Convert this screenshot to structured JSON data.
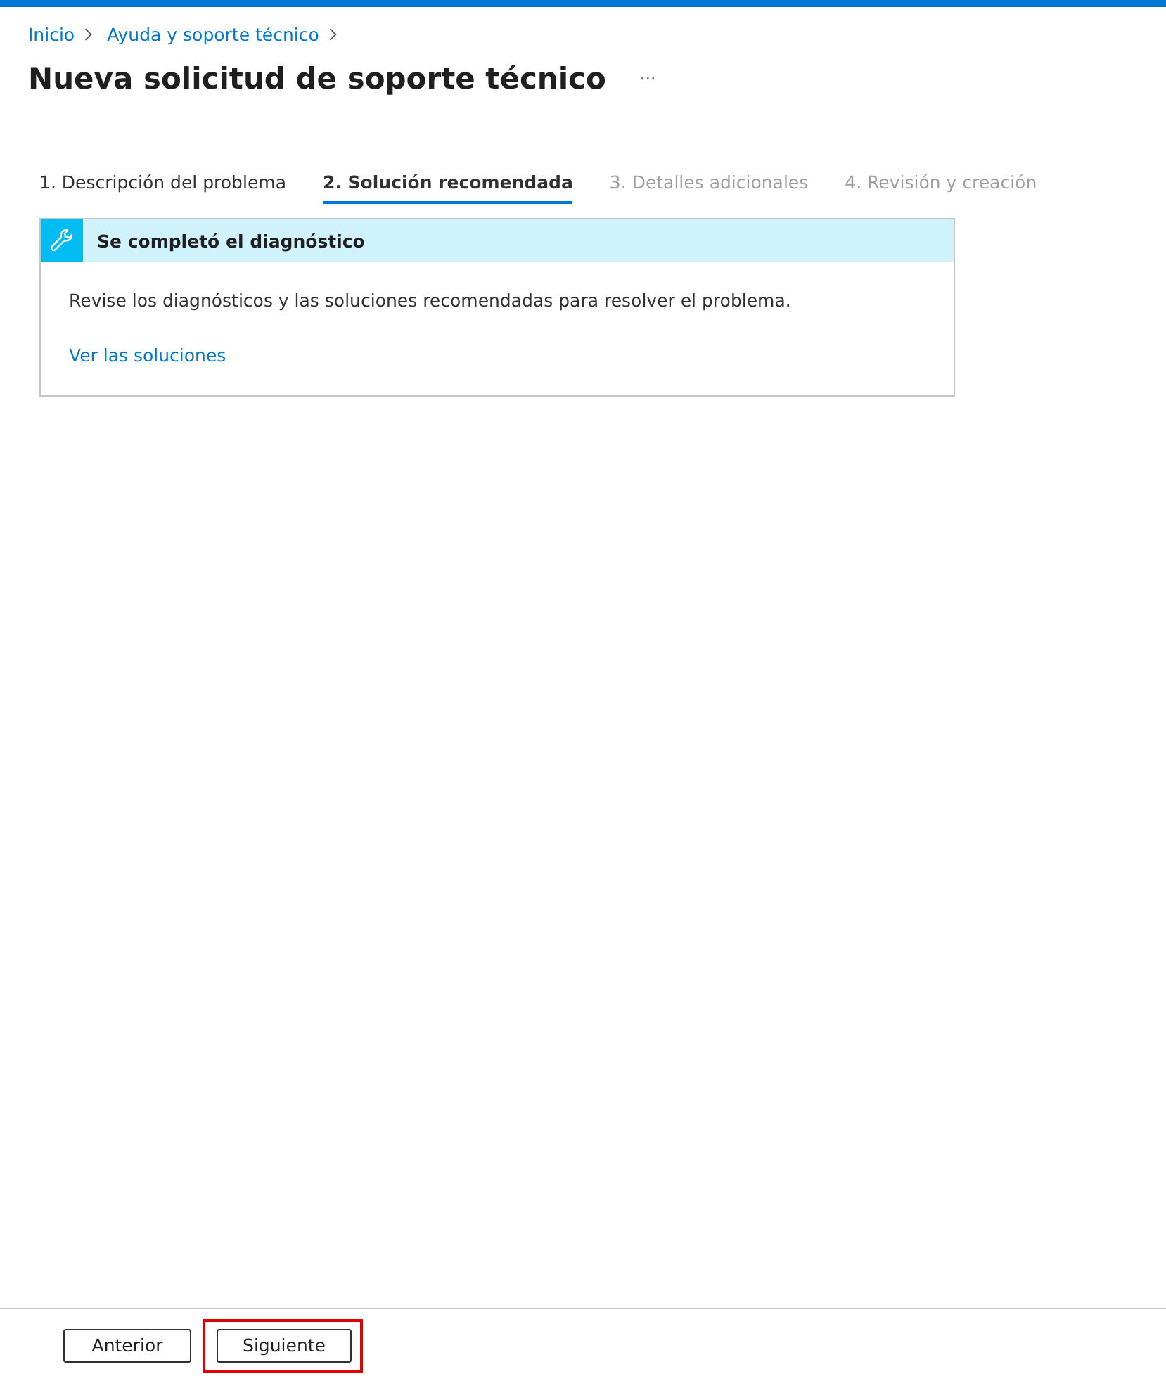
{
  "breadcrumb": [
    {
      "label": "Inicio"
    },
    {
      "label": "Ayuda y soporte técnico"
    }
  ],
  "title": "Nueva solicitud de soporte técnico",
  "more_menu": "···",
  "tabs": [
    {
      "label": "1. Descripción del problema",
      "selected": false,
      "disabled": false
    },
    {
      "label": "2. Solución recomendada",
      "selected": true,
      "disabled": false
    },
    {
      "label": "3. Detalles adicionales",
      "selected": false,
      "disabled": true
    },
    {
      "label": "4. Revisión y creación",
      "selected": false,
      "disabled": true
    }
  ],
  "diagnostic_card": {
    "title": "Se completó el diagnóstico",
    "message": "Revise los diagnósticos y las soluciones recomendadas para resolver el problema.",
    "link": "Ver las soluciones"
  },
  "footer_buttons": [
    {
      "label": "Anterior",
      "highlighted": false
    },
    {
      "label": "Siguiente",
      "highlighted": true
    }
  ]
}
